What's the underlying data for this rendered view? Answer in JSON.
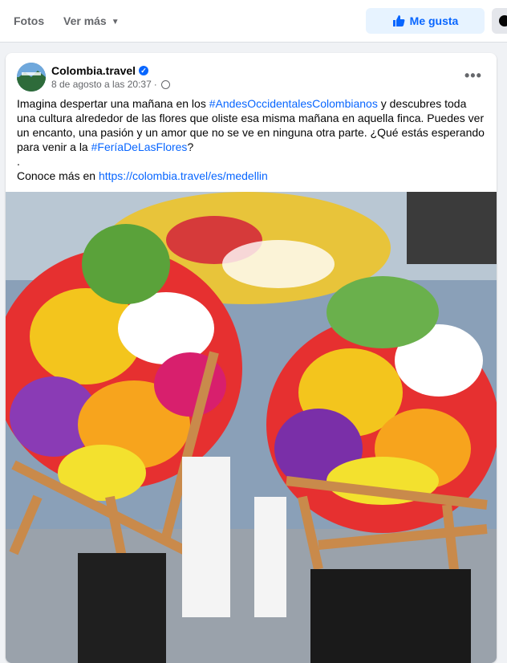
{
  "topbar": {
    "tabs": [
      {
        "label": "Fotos"
      },
      {
        "label": "Ver más"
      }
    ],
    "like_label": "Me gusta"
  },
  "post": {
    "page_name": "Colombia.travel",
    "date": "8 de agosto a las 20:37",
    "separator": "·",
    "text": {
      "part1": "Imagina despertar una mañana en los ",
      "hashtag1": "#AndesOccidentalesColombianos",
      "part2": " y descubres toda una cultura alrededor de las flores que oliste esa misma mañana en aquella finca. Puedes ver un encanto, una pasión y un amor que no se ve en ninguna otra parte. ¿Qué estás esperando para venir a  la ",
      "hashtag2": "#FeríaDeLasFlores",
      "part3": "?",
      "dot": ".",
      "link_prefix": "Conoce más en ",
      "link": "https://colombia.travel/es/medellin"
    },
    "image_alt": "Silleteros carrying wooden frames full of colorful flowers"
  },
  "colors": {
    "accent": "#0866ff",
    "like_bg": "#e7f3ff",
    "page_bg": "#f0f2f5"
  },
  "icons": [
    "chevron-down-icon",
    "thumbs-up-icon",
    "messenger-icon",
    "verified-badge-icon",
    "globe-icon",
    "more-options-icon"
  ]
}
